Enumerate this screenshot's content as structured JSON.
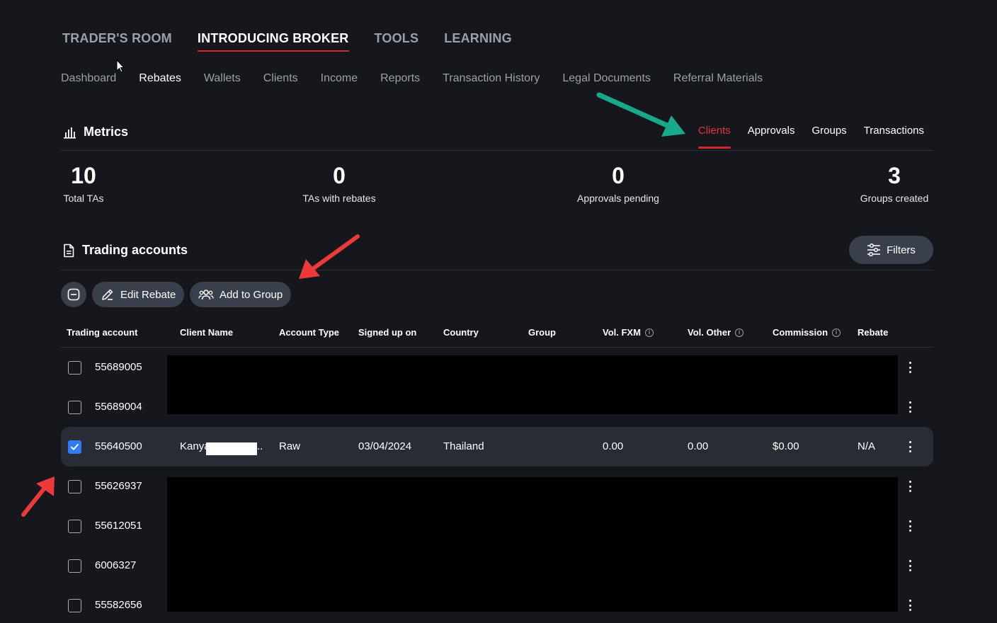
{
  "top_nav": [
    {
      "label": "TRADER'S ROOM",
      "active": false
    },
    {
      "label": "INTRODUCING BROKER",
      "active": true
    },
    {
      "label": "TOOLS",
      "active": false
    },
    {
      "label": "LEARNING",
      "active": false
    }
  ],
  "sub_nav": [
    {
      "label": "Dashboard",
      "active": false
    },
    {
      "label": "Rebates",
      "active": true
    },
    {
      "label": "Wallets",
      "active": false
    },
    {
      "label": "Clients",
      "active": false
    },
    {
      "label": "Income",
      "active": false
    },
    {
      "label": "Reports",
      "active": false
    },
    {
      "label": "Transaction History",
      "active": false
    },
    {
      "label": "Legal Documents",
      "active": false
    },
    {
      "label": "Referral Materials",
      "active": false
    }
  ],
  "metrics": {
    "title": "Metrics",
    "tabs": [
      "Clients",
      "Approvals",
      "Groups",
      "Transactions"
    ],
    "active_tab": "Clients",
    "items": [
      {
        "value": "10",
        "label": "Total TAs"
      },
      {
        "value": "0",
        "label": "TAs with rebates"
      },
      {
        "value": "0",
        "label": "Approvals pending"
      },
      {
        "value": "3",
        "label": "Groups created"
      }
    ]
  },
  "trading_accounts": {
    "title": "Trading accounts",
    "filters_label": "Filters",
    "edit_rebate_label": "Edit Rebate",
    "add_to_group_label": "Add to Group",
    "columns": [
      "Trading account",
      "Client Name",
      "Account Type",
      "Signed up on",
      "Country",
      "Group",
      "Vol. FXM",
      "Vol. Other",
      "Commission",
      "Rebate"
    ],
    "rows": [
      {
        "account": "55689005",
        "checked": false,
        "client_name": "",
        "account_type": "",
        "signed_up": "",
        "country": "",
        "group": "",
        "vol_fxm": "",
        "vol_other": "",
        "commission": "",
        "rebate": ""
      },
      {
        "account": "55689004",
        "checked": false,
        "client_name": "",
        "account_type": "",
        "signed_up": "",
        "country": "",
        "group": "",
        "vol_fxm": "",
        "vol_other": "",
        "commission": "",
        "rebate": ""
      },
      {
        "account": "55640500",
        "checked": true,
        "client_name": "Kanya",
        "client_name_suffix": "..",
        "account_type": "Raw",
        "signed_up": "03/04/2024",
        "country": "Thailand",
        "group": "",
        "vol_fxm": "0.00",
        "vol_other": "0.00",
        "commission": "$0.00",
        "rebate": "N/A"
      },
      {
        "account": "55626937",
        "checked": false,
        "client_name": "",
        "account_type": "",
        "signed_up": "",
        "country": "",
        "group": "",
        "vol_fxm": "",
        "vol_other": "",
        "commission": "",
        "rebate": ""
      },
      {
        "account": "55612051",
        "checked": false,
        "client_name": "",
        "account_type": "",
        "signed_up": "",
        "country": "",
        "group": "",
        "vol_fxm": "",
        "vol_other": "",
        "commission": "",
        "rebate": ""
      },
      {
        "account": "6006327",
        "checked": false,
        "client_name": "",
        "account_type": "",
        "signed_up": "",
        "country": "",
        "group": "",
        "vol_fxm": "",
        "vol_other": "",
        "commission": "",
        "rebate": ""
      },
      {
        "account": "55582656",
        "checked": false,
        "client_name": "",
        "account_type": "",
        "signed_up": "",
        "country": "",
        "group": "",
        "vol_fxm": "",
        "vol_other": "",
        "commission": "",
        "rebate": ""
      }
    ]
  },
  "colors": {
    "background": "#15171c",
    "accent_red": "#d8262f",
    "checkbox_blue": "#2f7df6",
    "annotation_green": "#17a98a",
    "annotation_red": "#ec3a3a"
  }
}
